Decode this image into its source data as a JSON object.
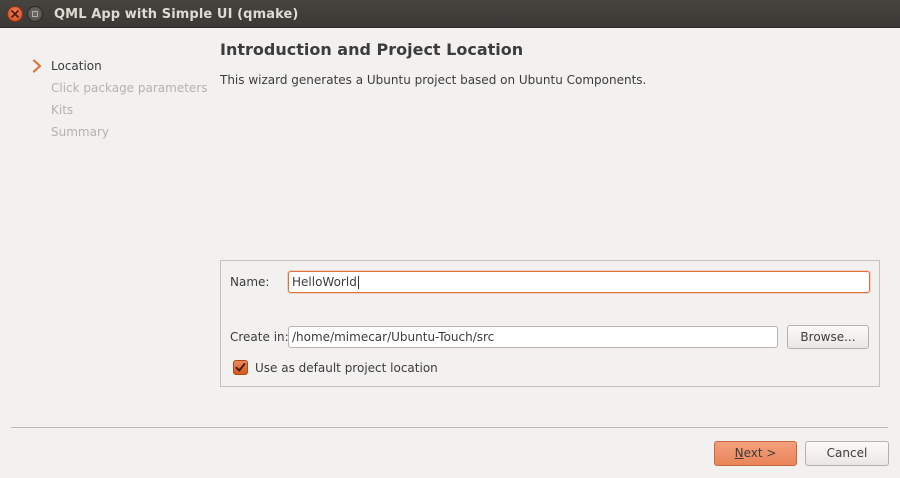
{
  "window": {
    "title": "QML App with Simple UI (qmake)"
  },
  "steps": [
    {
      "label": "Location",
      "state": "active"
    },
    {
      "label": "Click package parameters",
      "state": "inactive"
    },
    {
      "label": "Kits",
      "state": "inactive"
    },
    {
      "label": "Summary",
      "state": "inactive"
    }
  ],
  "page": {
    "title": "Introduction and Project Location",
    "subtitle": "This wizard generates a Ubuntu project based on Ubuntu Components."
  },
  "form": {
    "name_label": "Name:",
    "name_value": "HelloWorld",
    "create_in_label": "Create in:",
    "create_in_value": "/home/mimecar/Ubuntu-Touch/src",
    "browse_label": "Browse...",
    "default_location_label": "Use as default project location",
    "default_location_checked": true
  },
  "footer": {
    "next_mnemonic": "N",
    "next_rest": "ext >",
    "cancel_label": "Cancel"
  },
  "colors": {
    "accent": "#e0703c",
    "titlebar": "#3c3b37",
    "background": "#f2f1f0"
  }
}
